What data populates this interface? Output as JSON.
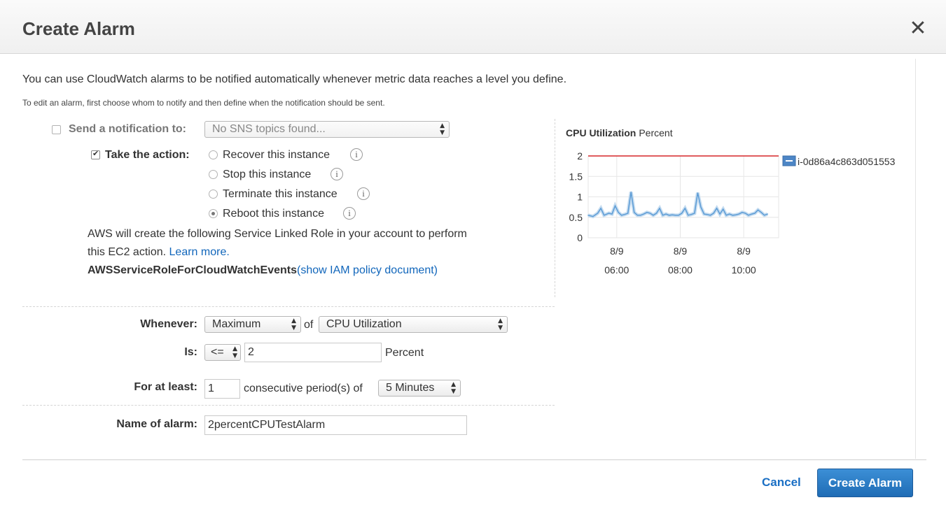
{
  "dialog": {
    "title": "Create Alarm",
    "close_symbol": "✕",
    "intro": "You can use CloudWatch alarms to be notified automatically whenever metric data reaches a level you define.",
    "subintro": "To edit an alarm, first choose whom to notify and then define when the notification should be sent."
  },
  "notification": {
    "checked": false,
    "label": "Send a notification to:",
    "select_value": "No SNS topics found..."
  },
  "action": {
    "checked": true,
    "label": "Take the action:",
    "options": [
      {
        "label": "Recover this instance",
        "selected": false
      },
      {
        "label": "Stop this instance",
        "selected": false
      },
      {
        "label": "Terminate this instance",
        "selected": false
      },
      {
        "label": "Reboot this instance",
        "selected": true
      }
    ],
    "info_symbol": "i",
    "role_text_1": "AWS will create the following Service Linked Role in your account to perform",
    "role_text_2": "this EC2 action.",
    "learn_more": "Learn more.",
    "role_name": "AWSServiceRoleForCloudWatchEvents",
    "policy_link": "(show IAM policy document)"
  },
  "condition": {
    "whenever_label": "Whenever:",
    "statistic": "Maximum",
    "of_label": "of",
    "metric": "CPU Utilization",
    "is_label": "Is:",
    "operator": "<=",
    "threshold": "2",
    "unit": "Percent",
    "for_at_least_label": "For at least:",
    "periods": "1",
    "periods_text": "consecutive period(s) of",
    "period_length": "5 Minutes"
  },
  "alarm_name": {
    "label": "Name of alarm:",
    "value": "2percentCPUTestAlarm"
  },
  "footer": {
    "cancel": "Cancel",
    "create": "Create Alarm"
  },
  "colors": {
    "threshold_line": "#d62728",
    "series_line": "#5b9bd5",
    "primary_button": "#2a78c2",
    "link": "#1166bb"
  },
  "chart_data": {
    "type": "line",
    "title": "CPU Utilization",
    "subtitle": "Percent",
    "ylim": [
      0,
      2
    ],
    "yticks": [
      "0",
      "0.5",
      "1",
      "1.5",
      "2"
    ],
    "xlim": [
      5.1,
      11.1
    ],
    "xticks": [
      {
        "x": 6,
        "date": "8/9",
        "time": "06:00"
      },
      {
        "x": 8,
        "date": "8/9",
        "time": "08:00"
      },
      {
        "x": 10,
        "date": "8/9",
        "time": "10:00"
      }
    ],
    "legend": {
      "label": "i-0d86a4c863d051553",
      "position": "top-right"
    },
    "threshold": 2,
    "series": [
      {
        "name": "i-0d86a4c863d051553",
        "x": [
          5.1,
          5.25,
          5.4,
          5.5,
          5.6,
          5.75,
          5.85,
          5.95,
          6.05,
          6.15,
          6.25,
          6.35,
          6.45,
          6.55,
          6.65,
          6.75,
          6.85,
          6.95,
          7.05,
          7.15,
          7.25,
          7.35,
          7.45,
          7.55,
          7.65,
          7.75,
          7.85,
          7.95,
          8.05,
          8.15,
          8.25,
          8.35,
          8.45,
          8.55,
          8.65,
          8.75,
          8.85,
          8.95,
          9.05,
          9.15,
          9.25,
          9.35,
          9.45,
          9.55,
          9.65,
          9.75,
          9.85,
          9.95,
          10.05,
          10.15,
          10.25,
          10.35,
          10.45,
          10.55,
          10.65,
          10.75
        ],
        "values": [
          0.55,
          0.52,
          0.6,
          0.72,
          0.55,
          0.6,
          0.58,
          0.78,
          0.62,
          0.55,
          0.57,
          0.6,
          1.12,
          0.62,
          0.55,
          0.55,
          0.58,
          0.62,
          0.6,
          0.55,
          0.6,
          0.72,
          0.55,
          0.58,
          0.55,
          0.56,
          0.55,
          0.55,
          0.6,
          0.72,
          0.55,
          0.57,
          0.6,
          1.1,
          0.75,
          0.58,
          0.57,
          0.55,
          0.6,
          0.72,
          0.58,
          0.7,
          0.55,
          0.58,
          0.55,
          0.56,
          0.58,
          0.62,
          0.6,
          0.55,
          0.58,
          0.6,
          0.68,
          0.62,
          0.55,
          0.58
        ]
      }
    ]
  }
}
